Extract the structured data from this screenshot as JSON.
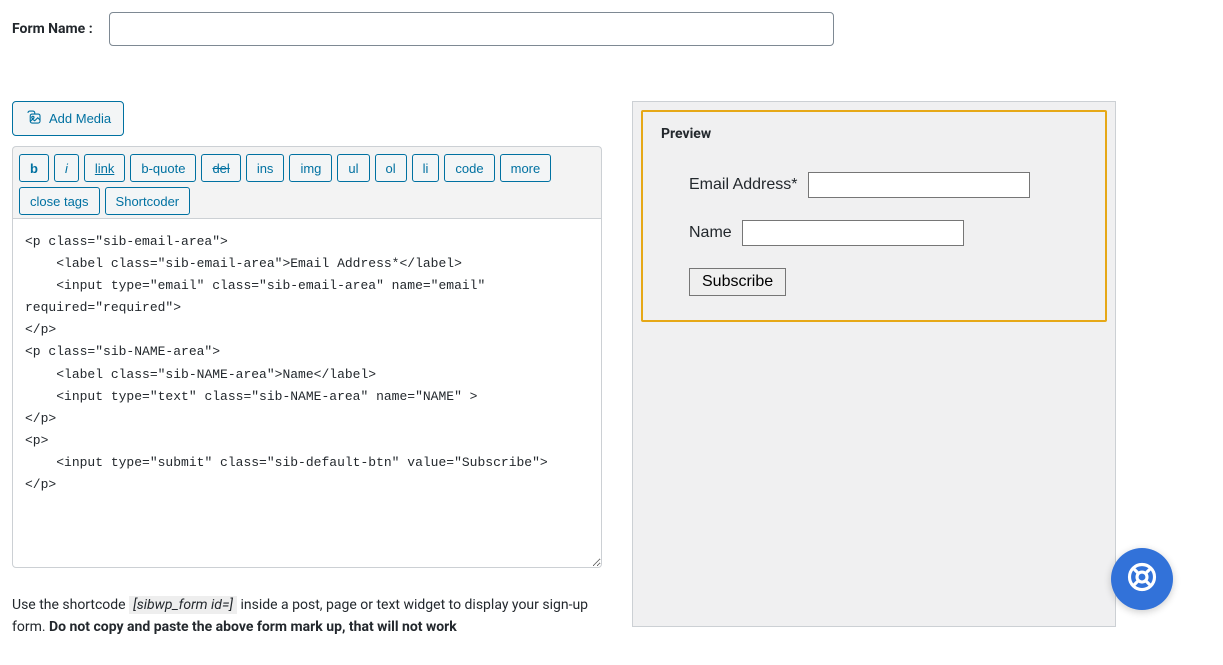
{
  "form_name_label": "Form Name :",
  "form_name_value": "",
  "add_media_label": "Add Media",
  "toolbar": {
    "b": "b",
    "i": "i",
    "link": "link",
    "b_quote": "b-quote",
    "del": "del",
    "ins": "ins",
    "img": "img",
    "ul": "ul",
    "ol": "ol",
    "li": "li",
    "code": "code",
    "more": "more",
    "close_tags": "close tags",
    "shortcoder": "Shortcoder"
  },
  "editor_content": "<p class=\"sib-email-area\">\n    <label class=\"sib-email-area\">Email Address*</label>\n    <input type=\"email\" class=\"sib-email-area\" name=\"email\" required=\"required\">\n</p>\n<p class=\"sib-NAME-area\">\n    <label class=\"sib-NAME-area\">Name</label>\n    <input type=\"text\" class=\"sib-NAME-area\" name=\"NAME\" >\n</p>\n<p>\n    <input type=\"submit\" class=\"sib-default-btn\" value=\"Subscribe\">\n</p>",
  "hint": {
    "prefix": "Use the shortcode ",
    "shortcode": "[sibwp_form id=]",
    "middle": " inside a post, page or text widget to display your sign-up form. ",
    "bold": "Do not copy and paste the above form mark up, that will not work"
  },
  "preview": {
    "title": "Preview",
    "email_label": "Email Address*",
    "name_label": "Name",
    "subscribe_label": "Subscribe"
  }
}
